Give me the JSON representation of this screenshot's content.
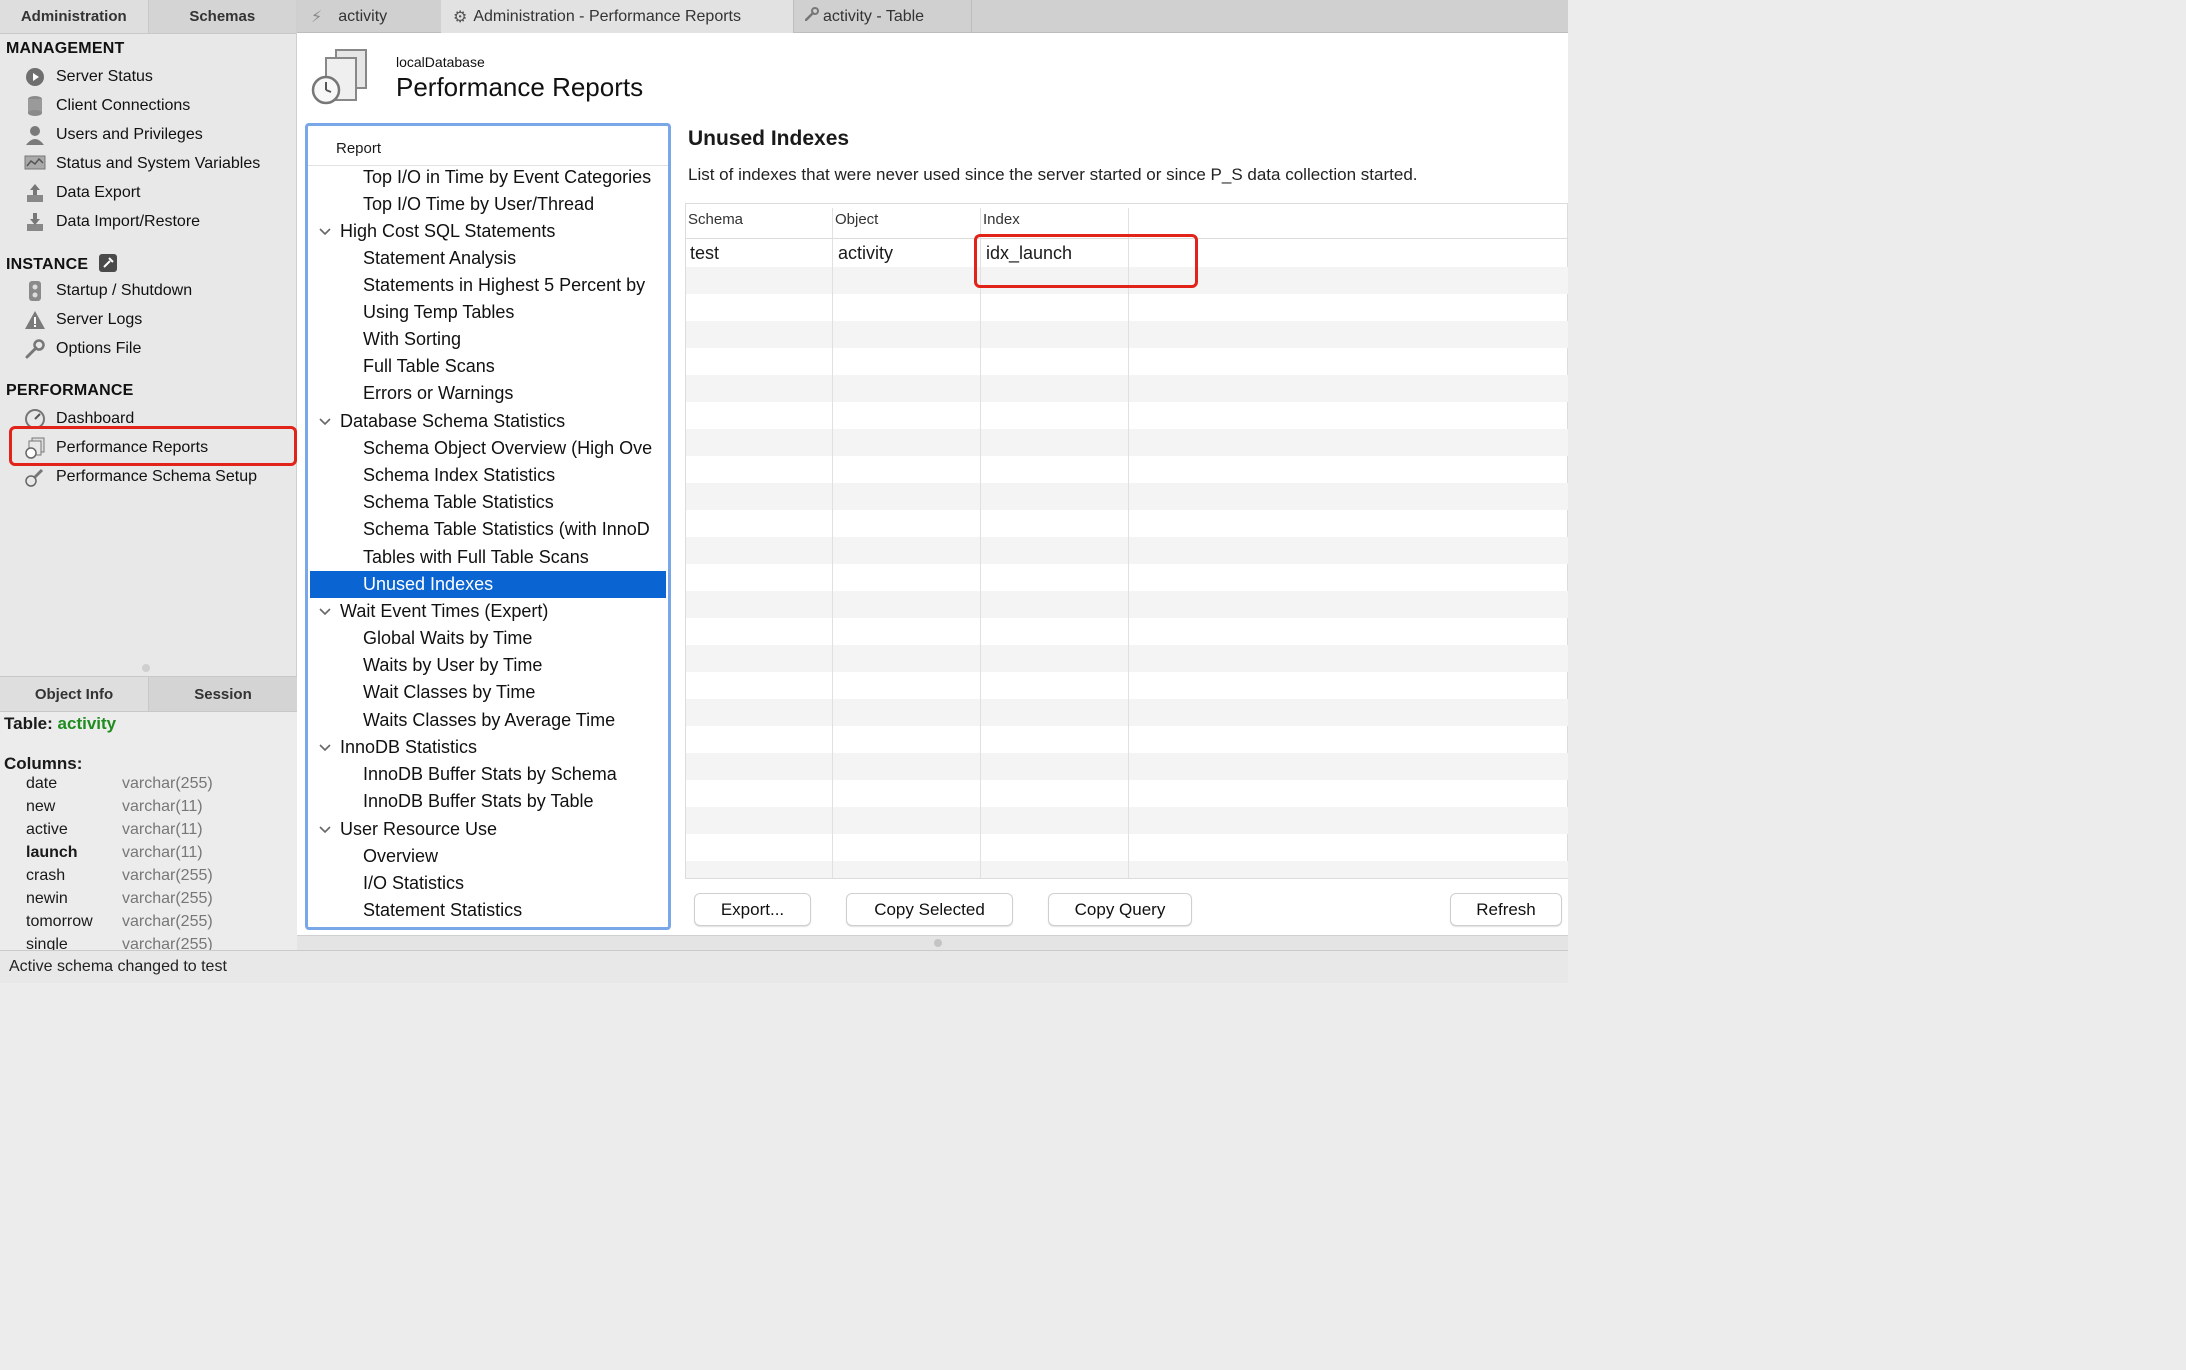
{
  "sidebar": {
    "tabs": [
      "Administration",
      "Schemas"
    ],
    "management": {
      "title": "MANAGEMENT",
      "items": [
        "Server Status",
        "Client Connections",
        "Users and Privileges",
        "Status and System Variables",
        "Data Export",
        "Data Import/Restore"
      ]
    },
    "instance": {
      "title": "INSTANCE",
      "items": [
        "Startup / Shutdown",
        "Server Logs",
        "Options File"
      ]
    },
    "performance": {
      "title": "PERFORMANCE",
      "items": [
        "Dashboard",
        "Performance Reports",
        "Performance Schema Setup"
      ]
    }
  },
  "object_info": {
    "tabs": [
      "Object Info",
      "Session"
    ],
    "table_label": "Table:",
    "table_name": "activity",
    "columns_label": "Columns:",
    "columns": [
      {
        "name": "date",
        "type": "varchar(255)"
      },
      {
        "name": "new",
        "type": "varchar(11)"
      },
      {
        "name": "active",
        "type": "varchar(11)"
      },
      {
        "name": "launch",
        "type": "varchar(11)"
      },
      {
        "name": "crash",
        "type": "varchar(255)"
      },
      {
        "name": "newin",
        "type": "varchar(255)"
      },
      {
        "name": "tomorrow",
        "type": "varchar(255)"
      },
      {
        "name": "single",
        "type": "varchar(255)"
      }
    ]
  },
  "doc_tabs": [
    "activity",
    "Administration - Performance Reports",
    "activity - Table"
  ],
  "header": {
    "subtitle": "localDatabase",
    "title": "Performance Reports"
  },
  "report_tree": {
    "header": "Report",
    "rows": [
      "Top I/O in Time by Event Categories",
      "Top I/O Time by User/Thread",
      "High Cost SQL Statements",
      "Statement Analysis",
      "Statements in Highest 5 Percent by",
      "Using Temp Tables",
      "With Sorting",
      "Full Table Scans",
      "Errors or Warnings",
      "Database Schema Statistics",
      "Schema Object Overview (High Ove",
      "Schema Index Statistics",
      "Schema Table Statistics",
      "Schema Table Statistics (with InnoD",
      "Tables with Full Table Scans",
      "Unused Indexes",
      "Wait Event Times (Expert)",
      "Global Waits by Time",
      "Waits by User by Time",
      "Wait Classes by Time",
      "Waits Classes by Average Time",
      "InnoDB Statistics",
      "InnoDB Buffer Stats by Schema",
      "InnoDB Buffer Stats by Table",
      "User Resource Use",
      "Overview",
      "I/O Statistics",
      "Statement Statistics"
    ]
  },
  "report": {
    "title": "Unused Indexes",
    "description": "List of indexes that were never used since the server started or since P_S data collection started.",
    "columns": [
      "Schema",
      "Object",
      "Index"
    ],
    "rows": [
      [
        "test",
        "activity",
        "idx_launch"
      ]
    ]
  },
  "buttons": {
    "export": "Export...",
    "copy_selected": "Copy Selected",
    "copy_query": "Copy Query",
    "refresh": "Refresh"
  },
  "status_bar": "Active schema changed to test",
  "colors": {
    "selection": "#0a64d2",
    "highlight": "#e2231a",
    "table_name": "#1e8c1e"
  }
}
